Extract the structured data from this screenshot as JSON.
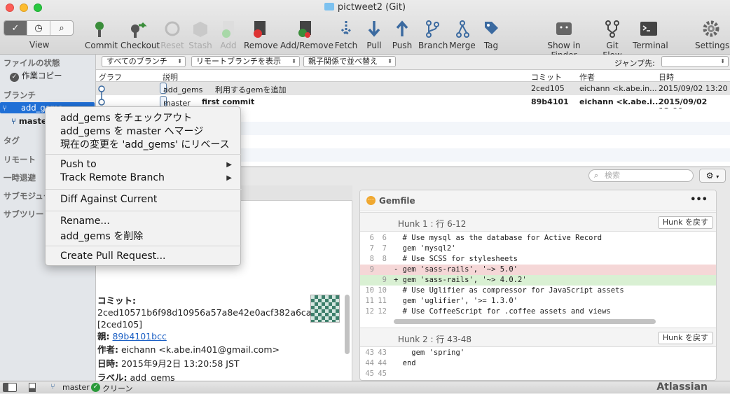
{
  "window": {
    "title": "pictweet2 (Git)"
  },
  "toolbar": {
    "view_label": "View",
    "buttons": [
      {
        "label": "Commit"
      },
      {
        "label": "Checkout"
      },
      {
        "label": "Reset"
      },
      {
        "label": "Stash"
      },
      {
        "label": "Add"
      },
      {
        "label": "Remove"
      },
      {
        "label": "Add/Remove"
      },
      {
        "label": "Fetch"
      },
      {
        "label": "Pull"
      },
      {
        "label": "Push"
      },
      {
        "label": "Branch"
      },
      {
        "label": "Merge"
      },
      {
        "label": "Tag"
      },
      {
        "label": "Show in Finder"
      },
      {
        "label": "Git Flow"
      },
      {
        "label": "Terminal"
      },
      {
        "label": "Settings"
      }
    ]
  },
  "sidebar": {
    "file_status_header": "ファイルの状態",
    "working_copy": "作業コピー",
    "branches_header": "ブランチ",
    "branches": [
      "add_gems",
      "master"
    ],
    "tags_header": "タグ",
    "remotes_header": "リモート",
    "stash_header": "一時退避",
    "submodules_header": "サブモジュール",
    "subtrees_header": "サブツリー"
  },
  "filter": {
    "branches_select": "すべてのブランチ",
    "remote_select": "リモートブランチを表示",
    "order_select": "親子関係で並べ替え",
    "jump_label": "ジャンプ先:"
  },
  "log": {
    "columns": [
      "グラフ",
      "説明",
      "コミット",
      "作者",
      "日時"
    ],
    "rows": [
      {
        "tag": "add_gems",
        "message": "利用するgemを追加",
        "commit": "2ced105",
        "author": "eichann <k.abe.in...",
        "date": "2015/09/02 13:20"
      },
      {
        "tag": "master",
        "message": "first commit",
        "commit": "89b4101",
        "author": "eichann <k.abe.i...",
        "date": "2015/09/02 13:00"
      }
    ]
  },
  "search": {
    "placeholder": "検索"
  },
  "commit_detail": {
    "commit_label": "コミット:",
    "hash": "2ced10571b6f98d10956a57a8e42e0acf382a6ca",
    "short": "[2ced105]",
    "parent_label": "親:",
    "parent": "89b4101bcc",
    "author_label": "作者:",
    "author": "eichann <k.abe.in401@gmail.com>",
    "date_label": "日時:",
    "date": "2015年9月2日 13:20:58 JST",
    "labels_label": "ラベル:",
    "labels": "add_gems"
  },
  "diff": {
    "file": "Gemfile",
    "more": "•••",
    "hunk1": {
      "title": "Hunk 1 : 行 6-12",
      "button": "Hunk を戻す"
    },
    "hunk1_lines": [
      {
        "o": "6",
        "n": "6",
        "code": "  # Use mysql as the database for Active Record",
        "t": "ctx"
      },
      {
        "o": "7",
        "n": "7",
        "code": "  gem 'mysql2'",
        "t": "ctx"
      },
      {
        "o": "8",
        "n": "8",
        "code": "  # Use SCSS for stylesheets",
        "t": "ctx"
      },
      {
        "o": "9",
        "n": "",
        "code": "- gem 'sass-rails', '~> 5.0'",
        "t": "del"
      },
      {
        "o": "",
        "n": "9",
        "code": "+ gem 'sass-rails', '~> 4.0.2'",
        "t": "add"
      },
      {
        "o": "10",
        "n": "10",
        "code": "  # Use Uglifier as compressor for JavaScript assets",
        "t": "ctx"
      },
      {
        "o": "11",
        "n": "11",
        "code": "  gem 'uglifier', '>= 1.3.0'",
        "t": "ctx"
      },
      {
        "o": "12",
        "n": "12",
        "code": "  # Use CoffeeScript for .coffee assets and views",
        "t": "ctx"
      }
    ],
    "hunk2": {
      "title": "Hunk 2 : 行 43-48",
      "button": "Hunk を戻す"
    },
    "hunk2_lines": [
      {
        "o": "43",
        "n": "43",
        "code": "    gem 'spring'",
        "t": "ctx"
      },
      {
        "o": "44",
        "n": "44",
        "code": "  end",
        "t": "ctx"
      },
      {
        "o": "45",
        "n": "45",
        "code": "",
        "t": "ctx"
      }
    ]
  },
  "context_menu": {
    "checkout": "add_gems をチェックアウト",
    "merge": "add_gems を master へマージ",
    "rebase": "現在の変更を 'add_gems' にリベース",
    "push_to": "Push to",
    "track_remote": "Track Remote Branch",
    "diff_current": "Diff Against Current",
    "rename": "Rename...",
    "delete": "add_gems を削除",
    "create_pr": "Create Pull Request..."
  },
  "statusbar": {
    "branch": "master",
    "clean": "クリーン",
    "brand": "Atlassian"
  },
  "colors": {
    "accent": "#2a7ad9",
    "selection": "#1f6fd6",
    "del": "#f5d7d7",
    "add": "#d9f0d3"
  }
}
